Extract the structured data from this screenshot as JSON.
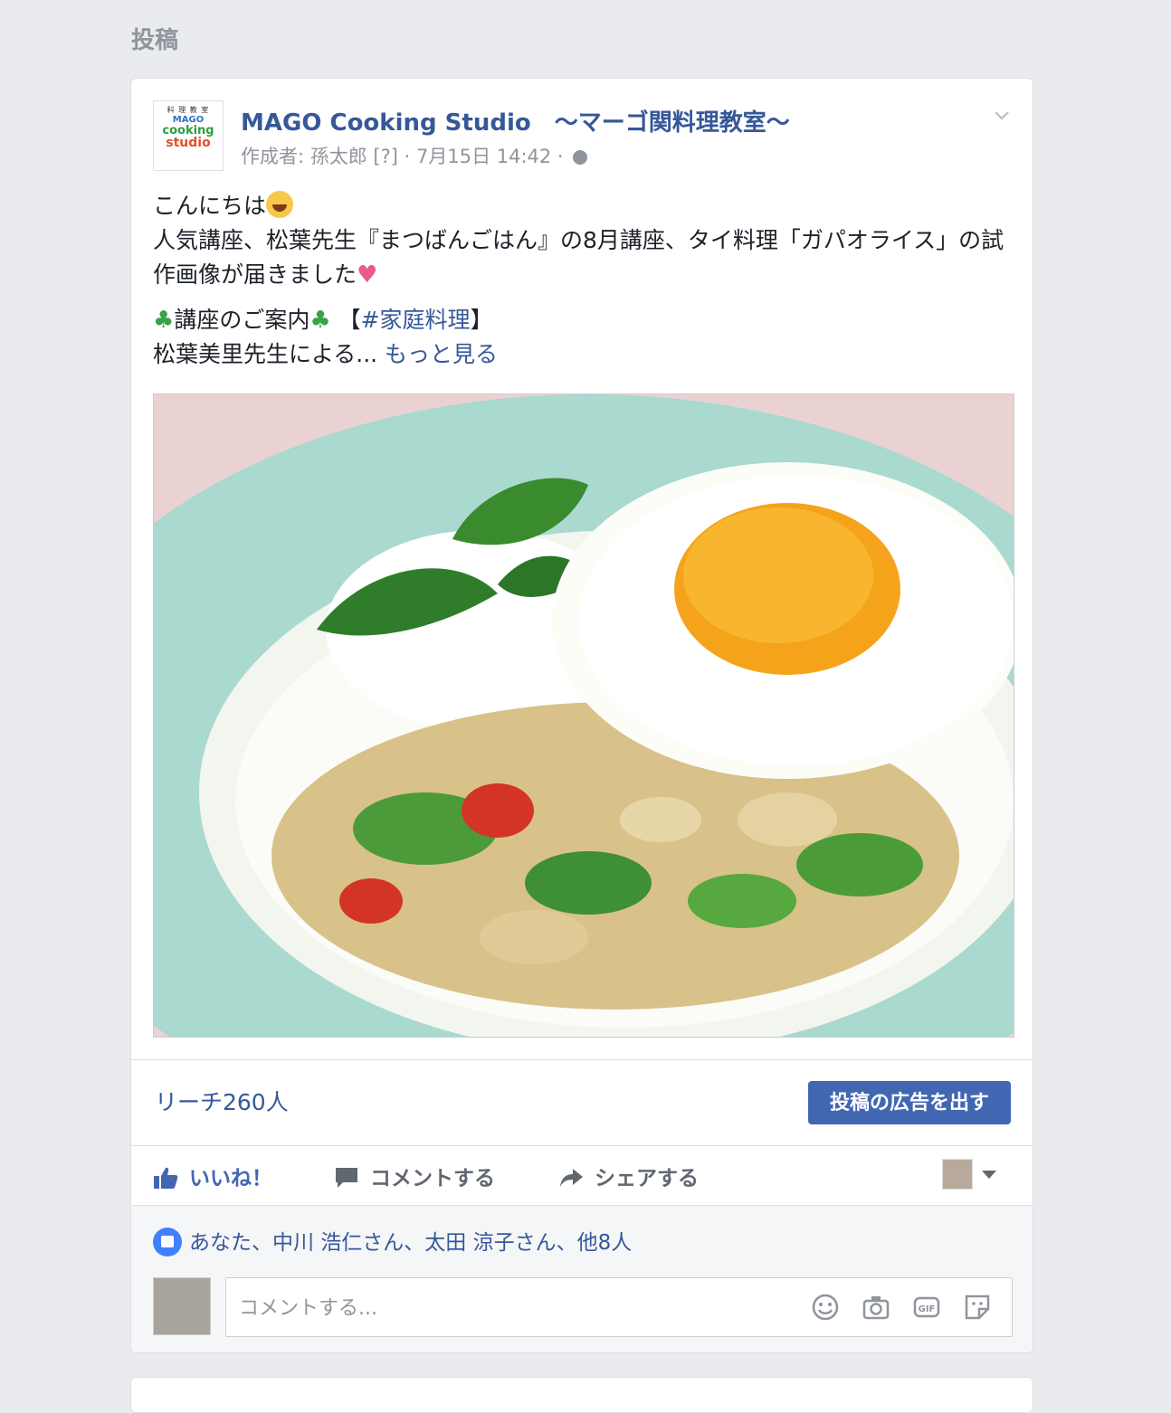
{
  "section": {
    "title": "投稿"
  },
  "post": {
    "page_name": "MAGO Cooking Studio　〜マーゴ関料理教室〜",
    "avatar": {
      "l1": "料 理 教 室",
      "l2": "MAGO",
      "l3": "cooking",
      "l4": "studio"
    },
    "meta": "作成者: 孫太郎 [?] · 7月15日 14:42 ·",
    "text": {
      "greeting": "こんにちは",
      "line2": "人気講座、松葉先生『まつばんごはん』の8月講座、タイ料理「ガパオライス」の試作画像が届きました",
      "course_label": "講座のご案内",
      "hashtag_prefix": "【",
      "hashtag": "#家庭料理",
      "hashtag_suffix": "】",
      "line4": "松葉美里先生による...",
      "see_more": "もっと見る"
    },
    "reach": "リーチ260人",
    "boost_label": "投稿の広告を出す",
    "actions": {
      "like": "いいね！",
      "comment": "コメントする",
      "share": "シェアする"
    },
    "likes_summary": "あなた、中川 浩仁さん、太田 涼子さん、他8人",
    "comment_placeholder": "コメントする..."
  },
  "icons": {
    "globe": "globe-icon",
    "chevron": "chevron-down-icon",
    "like": "thumbs-up-icon",
    "comment": "speech-bubble-icon",
    "share": "share-arrow-icon",
    "emoji": "emoji-icon",
    "camera": "camera-icon",
    "gif": "gif-icon",
    "sticker": "sticker-icon"
  },
  "colors": {
    "link": "#365899",
    "button": "#4267b2",
    "like_active": "#4267b2",
    "background": "#e9ebee"
  }
}
